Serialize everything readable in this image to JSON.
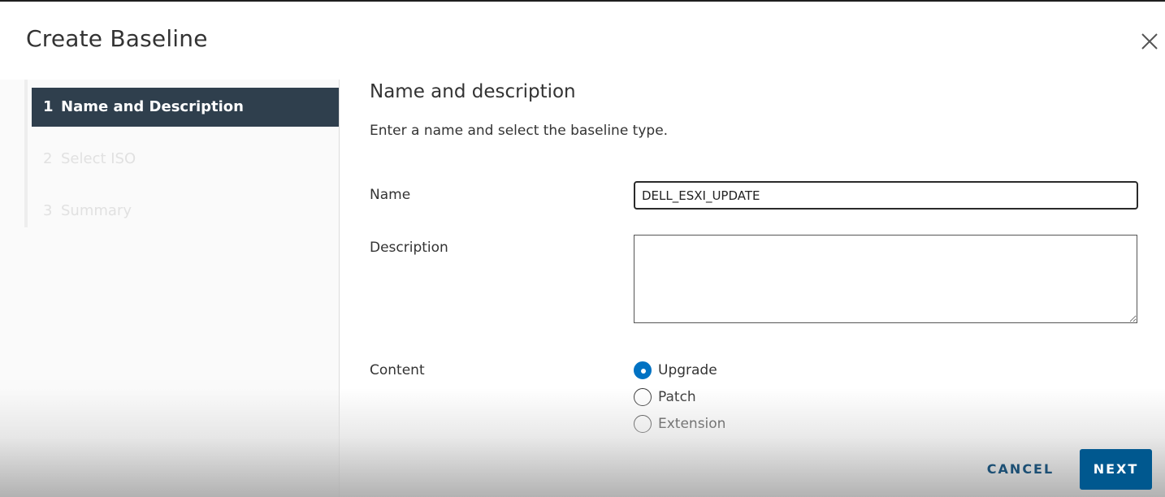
{
  "dialog": {
    "title": "Create Baseline"
  },
  "steps": [
    {
      "number": "1",
      "label": "Name and Description",
      "state": "active"
    },
    {
      "number": "2",
      "label": "Select ISO",
      "state": "disabled"
    },
    {
      "number": "3",
      "label": "Summary",
      "state": "disabled"
    }
  ],
  "content": {
    "title": "Name and description",
    "description": "Enter a name and select the baseline type."
  },
  "form": {
    "name_label": "Name",
    "name_value": "DELL_ESXI_UPDATE",
    "description_label": "Description",
    "description_value": "",
    "content_label": "Content",
    "options": [
      {
        "label": "Upgrade",
        "checked": true
      },
      {
        "label": "Patch",
        "checked": false
      },
      {
        "label": "Extension",
        "checked": false
      }
    ]
  },
  "footer": {
    "cancel_label": "CANCEL",
    "next_label": "NEXT"
  },
  "icons": {
    "close": "close-icon"
  },
  "colors": {
    "active_step_bg": "#2f3f4d",
    "primary": "#00588f",
    "radio_checked": "#0072c3",
    "link": "#1c4f74"
  }
}
